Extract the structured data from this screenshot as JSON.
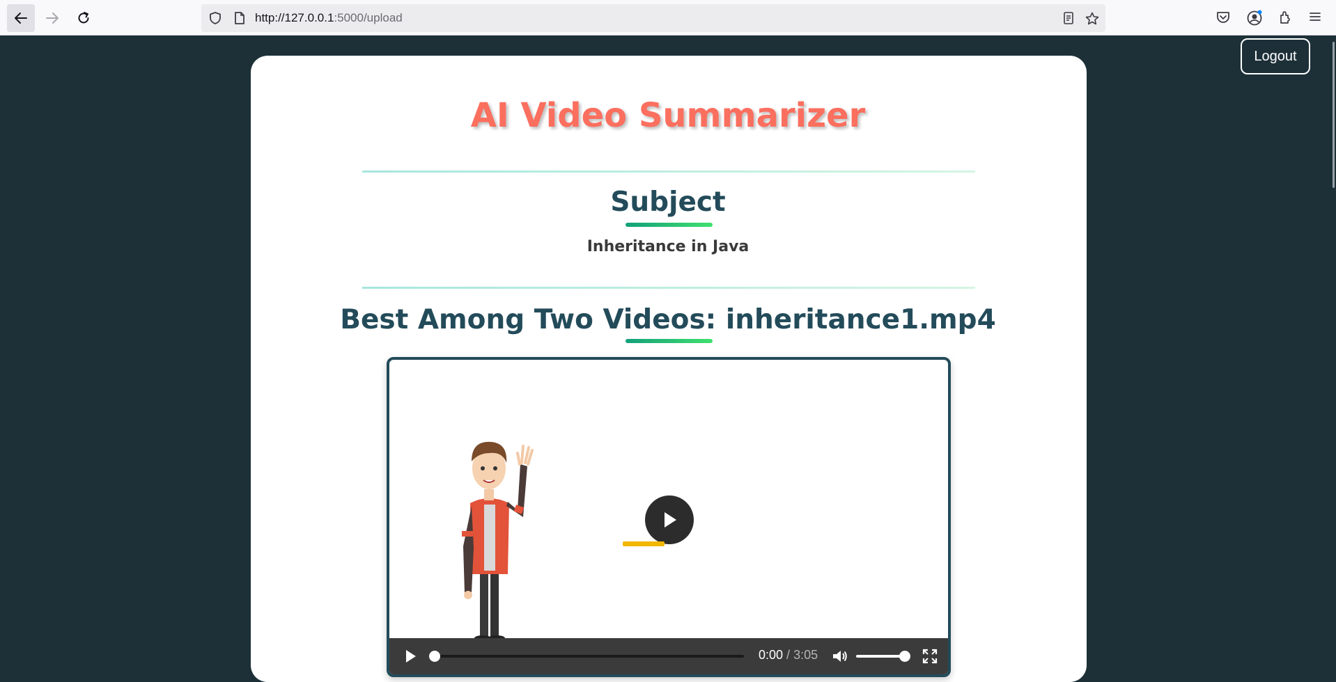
{
  "browser": {
    "url_host": "http://127.0.0.1",
    "url_rest": ":5000/upload"
  },
  "page": {
    "logout_label": "Logout",
    "title": "AI Video Summarizer",
    "subject_heading": "Subject",
    "subject_text": "Inheritance in Java",
    "best_heading": "Best Among Two Videos: inheritance1.mp4"
  },
  "video": {
    "current_time": "0:00",
    "separator": " / ",
    "duration": "3:05",
    "progress_fraction": 0.0,
    "volume_fraction": 1.0
  },
  "colors": {
    "title": "#fb6f5f",
    "heading": "#234b5a",
    "accent_green": "#40e06e",
    "background": "#1d3038"
  },
  "icons": [
    "back-arrow-icon",
    "forward-arrow-icon",
    "reload-icon",
    "shield-icon",
    "page-icon",
    "reader-view-icon",
    "bookmark-star-icon",
    "pocket-icon",
    "account-icon",
    "extensions-icon",
    "menu-icon",
    "play-icon",
    "volume-icon",
    "fullscreen-icon"
  ]
}
